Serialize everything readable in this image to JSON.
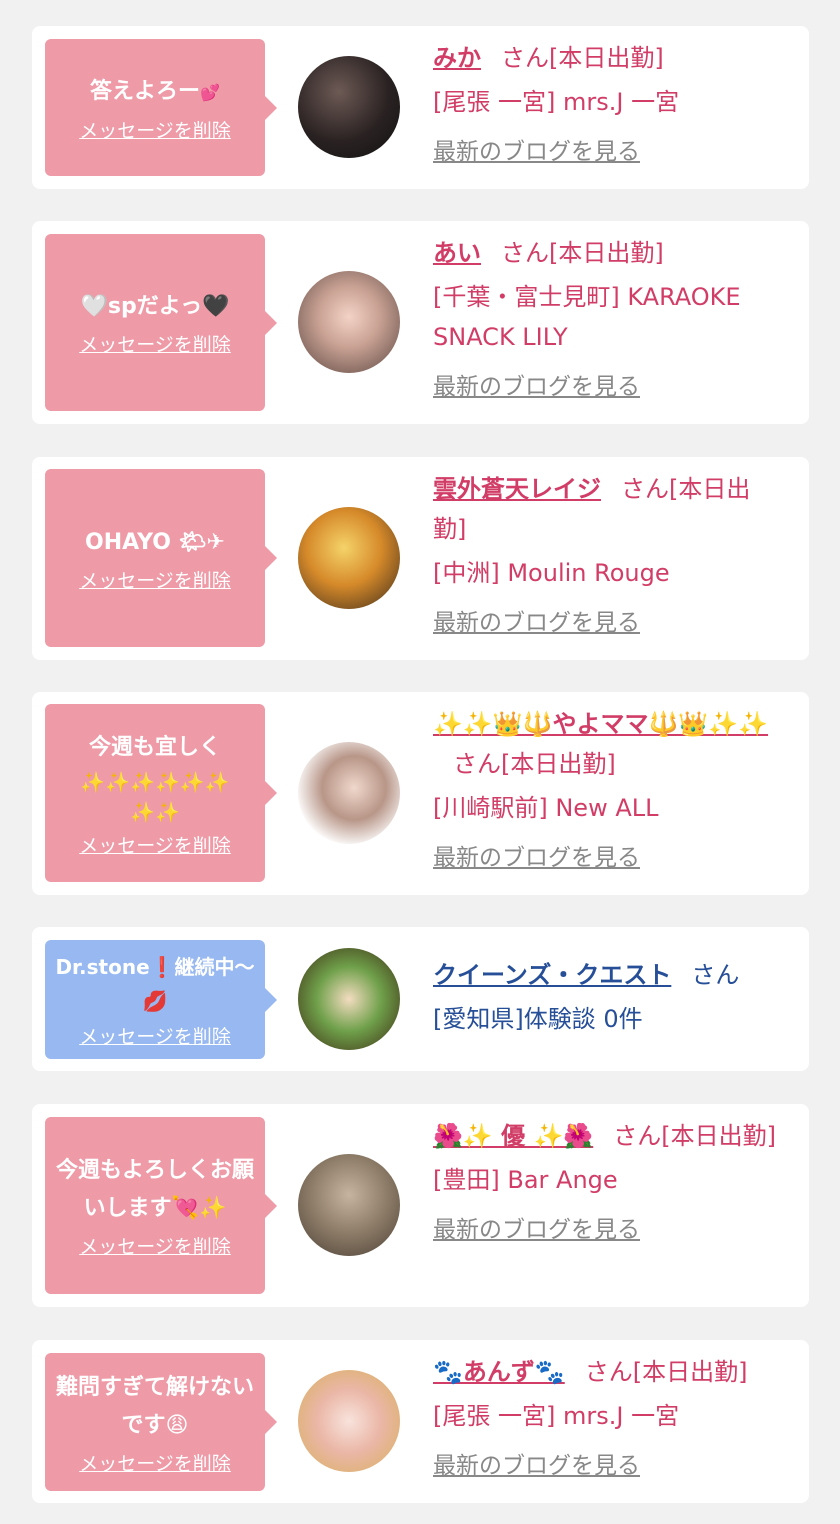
{
  "messages": [
    {
      "text": "答えよろー",
      "emoji": "💕",
      "delete_label": "メッセージを削除",
      "name": "みか",
      "suffix": "さん[本日出勤]",
      "shop": "[尾張 一宮] mrs.J 一宮",
      "blog_label": "最新のブログを見る",
      "bubble_color": "#ee9aa7"
    },
    {
      "text": "🤍spだよっ🖤",
      "emoji": "",
      "delete_label": "メッセージを削除",
      "name": "あい",
      "suffix": "さん[本日出勤]",
      "shop": "[千葉・富士見町] KARAOKE SNACK LILY",
      "blog_label": "最新のブログを見る",
      "bubble_color": "#ee9aa7"
    },
    {
      "text": "OHAYO",
      "emoji": "🌤✈",
      "delete_label": "メッセージを削除",
      "name": "雲外蒼天レイジ",
      "suffix": "さん[本日出勤]",
      "shop": "[中洲] Moulin Rouge",
      "blog_label": "最新のブログを見る",
      "bubble_color": "#ee9aa7"
    },
    {
      "text": "今週も宜しく",
      "emoji": "✨✨✨✨✨✨✨✨",
      "delete_label": "メッセージを削除",
      "name": "✨✨👑🔱やよママ🔱👑✨✨",
      "suffix": "さん[本日出勤]",
      "shop": "[川崎駅前] New ALL",
      "blog_label": "最新のブログを見る",
      "bubble_color": "#ee9aa7"
    },
    {
      "text": "Dr.stone❗継続中〜",
      "emoji": "💋",
      "delete_label": "メッセージを削除",
      "name": "クイーンズ・クエスト",
      "suffix": "さん",
      "shop": "[愛知県]体験談 0件",
      "blog_label": "",
      "bubble_color": "#97b8f0"
    },
    {
      "text": "今週もよろしくお願いします",
      "emoji": "💘✨",
      "delete_label": "メッセージを削除",
      "name": "🌺✨ 優 ✨🌺",
      "suffix": "さん[本日出勤]",
      "shop": "[豊田] Bar Ange",
      "blog_label": "最新のブログを見る",
      "bubble_color": "#ee9aa7"
    },
    {
      "text": "難問すぎて解けないです",
      "emoji": "😩",
      "delete_label": "メッセージを削除",
      "name": "🐾あんず🐾",
      "suffix": "さん[本日出勤]",
      "shop": "[尾張 一宮] mrs.J 一宮",
      "blog_label": "最新のブログを見る",
      "bubble_color": "#ee9aa7"
    }
  ]
}
